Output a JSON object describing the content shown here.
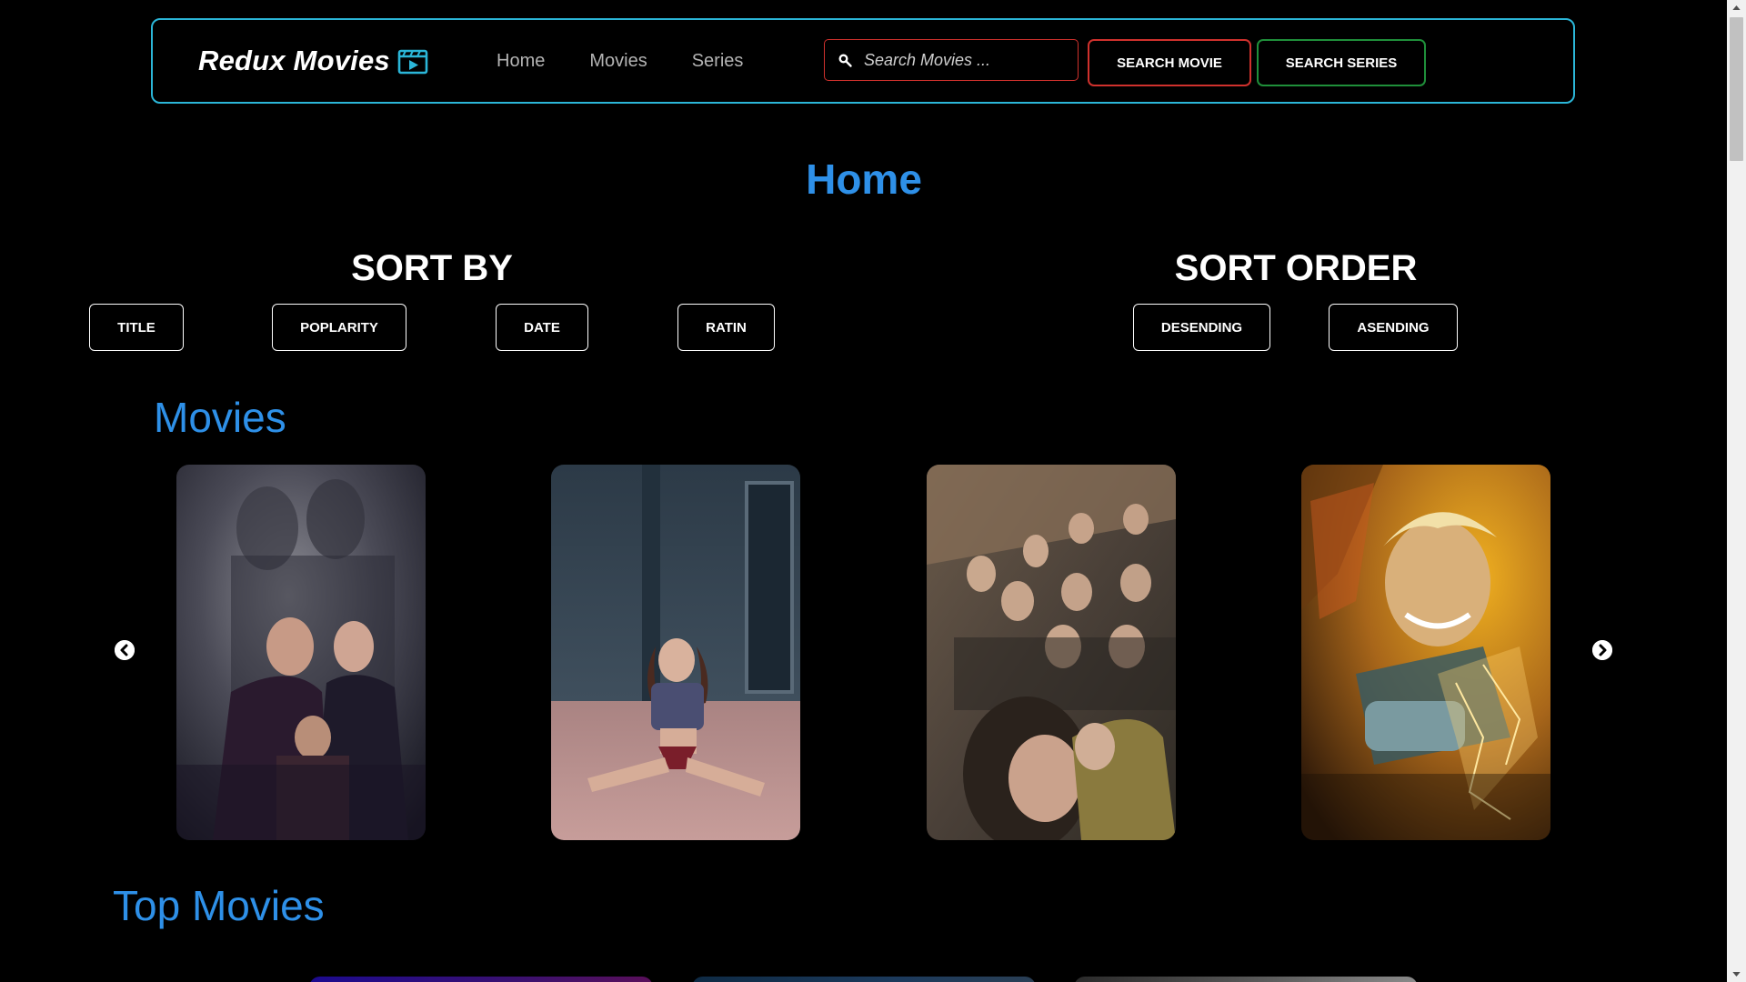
{
  "navbar": {
    "brand": "Redux Movies",
    "brand_icon": "clapperboard-play-icon",
    "links": [
      {
        "label": "Home"
      },
      {
        "label": "Movies"
      },
      {
        "label": "Series"
      }
    ],
    "search": {
      "placeholder": "Search Movies ...",
      "value": "",
      "icon": "search-icon"
    },
    "search_movie_label": "SEARCH MOVIE",
    "search_series_label": "SEARCH SERIES"
  },
  "page": {
    "title": "Home"
  },
  "sort_by": {
    "heading": "SORT BY",
    "options": [
      "TITLE",
      "POPLARITY",
      "DATE",
      "RATIN"
    ]
  },
  "sort_order": {
    "heading": "SORT ORDER",
    "options": [
      "DESENDING",
      "ASENDING"
    ]
  },
  "sections": {
    "movies_title": "Movies",
    "top_movies_title": "Top Movies"
  },
  "carousel": {
    "prev_icon": "chevron-left-icon",
    "next_icon": "chevron-right-icon",
    "posters": [
      {
        "name": "movie-poster-family-shadow"
      },
      {
        "name": "movie-poster-woman-split"
      },
      {
        "name": "movie-poster-airplane-crowd"
      },
      {
        "name": "movie-poster-man-shattered-glass"
      }
    ]
  },
  "colors": {
    "accent_blue": "#2e90e8",
    "nav_border": "#2bb6d8",
    "search_movie_border": "#d0312d",
    "search_series_border": "#1f8f3a",
    "background": "#000000"
  }
}
